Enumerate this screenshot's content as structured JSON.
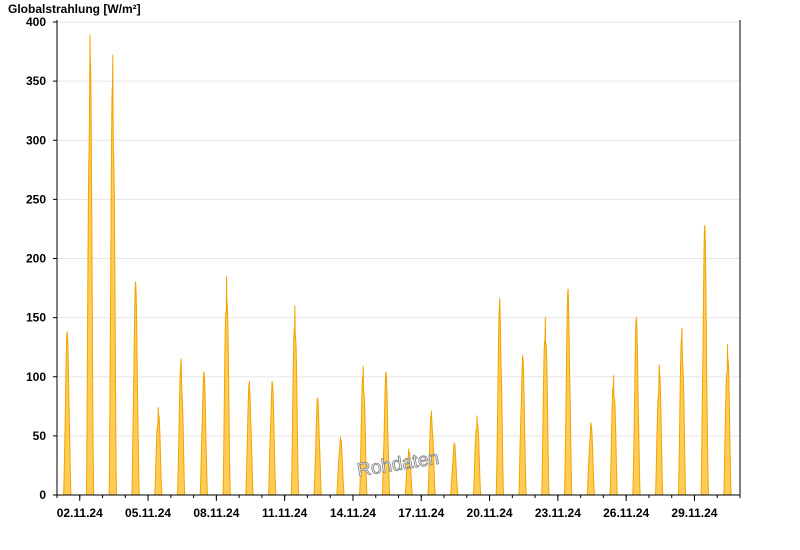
{
  "chart_data": {
    "type": "area",
    "title": "Globalstrahlung [W/m²]",
    "xlabel": "",
    "ylabel": "",
    "ylim": [
      0,
      400
    ],
    "yticks": [
      0,
      50,
      100,
      150,
      200,
      250,
      300,
      350,
      400
    ],
    "xlim": [
      0,
      30
    ],
    "xticks": [
      {
        "x": 1,
        "label": "02.11.24"
      },
      {
        "x": 4,
        "label": "05.11.24"
      },
      {
        "x": 7,
        "label": "08.11.24"
      },
      {
        "x": 10,
        "label": "11.11.24"
      },
      {
        "x": 13,
        "label": "14.11.24"
      },
      {
        "x": 16,
        "label": "17.11.24"
      },
      {
        "x": 19,
        "label": "20.11.24"
      },
      {
        "x": 22,
        "label": "23.11.24"
      },
      {
        "x": 25,
        "label": "26.11.24"
      },
      {
        "x": 28,
        "label": "29.11.24"
      }
    ],
    "grid": true,
    "colors": {
      "fill": "#FFCC55",
      "line": "#F2A300",
      "grid": "#e6e6e6",
      "axis": "#000000"
    },
    "daily_peaks": [
      {
        "day": "01.11.24",
        "peak": 138
      },
      {
        "day": "02.11.24",
        "peak": 389
      },
      {
        "day": "03.11.24",
        "peak": 372
      },
      {
        "day": "04.11.24",
        "peak": 180
      },
      {
        "day": "05.11.24",
        "peak": 74
      },
      {
        "day": "06.11.24",
        "peak": 115
      },
      {
        "day": "07.11.24",
        "peak": 104
      },
      {
        "day": "08.11.24",
        "peak": 185
      },
      {
        "day": "09.11.24",
        "peak": 96
      },
      {
        "day": "10.11.24",
        "peak": 96
      },
      {
        "day": "11.11.24",
        "peak": 160
      },
      {
        "day": "12.11.24",
        "peak": 82
      },
      {
        "day": "13.11.24",
        "peak": 49
      },
      {
        "day": "14.11.24",
        "peak": 109
      },
      {
        "day": "15.11.24",
        "peak": 104
      },
      {
        "day": "16.11.24",
        "peak": 39
      },
      {
        "day": "17.11.24",
        "peak": 71
      },
      {
        "day": "18.11.24",
        "peak": 44
      },
      {
        "day": "19.11.24",
        "peak": 67
      },
      {
        "day": "20.11.24",
        "peak": 166
      },
      {
        "day": "21.11.24",
        "peak": 118
      },
      {
        "day": "22.11.24",
        "peak": 150
      },
      {
        "day": "23.11.24",
        "peak": 174
      },
      {
        "day": "24.11.24",
        "peak": 61
      },
      {
        "day": "25.11.24",
        "peak": 101
      },
      {
        "day": "26.11.24",
        "peak": 150
      },
      {
        "day": "27.11.24",
        "peak": 110
      },
      {
        "day": "28.11.24",
        "peak": 141
      },
      {
        "day": "29.11.24",
        "peak": 228
      },
      {
        "day": "30.11.24",
        "peak": 127
      }
    ]
  },
  "watermark": "Rohdaten"
}
